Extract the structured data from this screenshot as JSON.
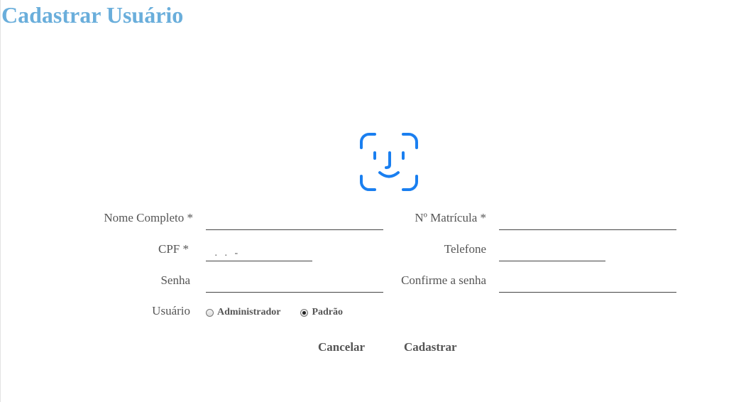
{
  "page": {
    "title": "Cadastrar Usuário"
  },
  "icons": {
    "face_id": "face-id-icon",
    "accent_color": "#1a7ff0"
  },
  "form": {
    "nome_completo": {
      "label": "Nome Completo *",
      "value": ""
    },
    "matricula": {
      "label": "Nº Matrícula *",
      "value": ""
    },
    "cpf": {
      "label": "CPF *",
      "value": "",
      "placeholder": "   .   .   -"
    },
    "telefone": {
      "label": "Telefone",
      "value": ""
    },
    "senha": {
      "label": "Senha",
      "value": ""
    },
    "confirme_senha": {
      "label": "Confirme a senha",
      "value": ""
    },
    "usuario": {
      "label": "Usuário",
      "options": [
        {
          "label": "Administrador",
          "checked": false
        },
        {
          "label": "Padrão",
          "checked": true
        }
      ]
    }
  },
  "actions": {
    "cancel_label": "Cancelar",
    "submit_label": "Cadastrar"
  },
  "colors": {
    "title": "#6aaedb",
    "text": "#555555"
  }
}
